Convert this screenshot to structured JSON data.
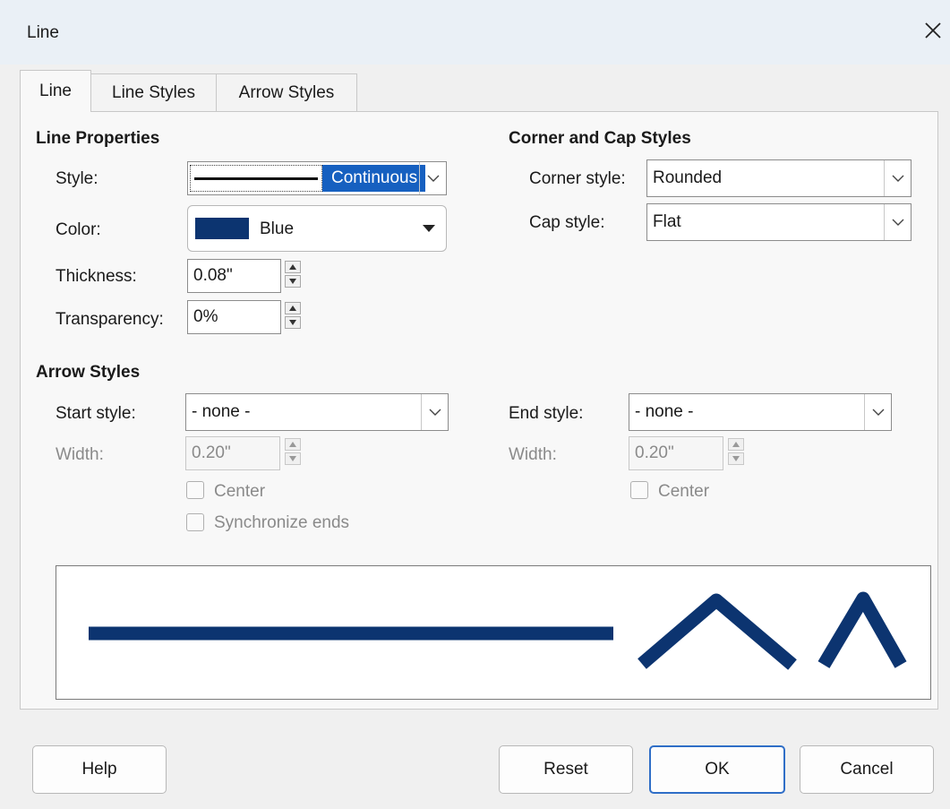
{
  "dialog": {
    "title": "Line"
  },
  "tabs": [
    {
      "label": "Line",
      "active": true
    },
    {
      "label": "Line Styles",
      "active": false
    },
    {
      "label": "Arrow Styles",
      "active": false
    }
  ],
  "line_properties": {
    "heading": "Line Properties",
    "style_label": "Style:",
    "style_value": "Continuous",
    "color_label": "Color:",
    "color_value": "Blue",
    "color_hex": "#0c3470",
    "thickness_label": "Thickness:",
    "thickness_value": "0.08\"",
    "transparency_label": "Transparency:",
    "transparency_value": "0%"
  },
  "corner_cap": {
    "heading": "Corner and Cap Styles",
    "corner_label": "Corner style:",
    "corner_value": "Rounded",
    "cap_label": "Cap style:",
    "cap_value": "Flat"
  },
  "arrow_styles": {
    "heading": "Arrow Styles",
    "start_label": "Start style:",
    "start_value": "- none -",
    "start_width_label": "Width:",
    "start_width_value": "0.20\"",
    "start_center_label": "Center",
    "sync_label": "Synchronize ends",
    "end_label": "End style:",
    "end_value": "- none -",
    "end_width_label": "Width:",
    "end_width_value": "0.20\"",
    "end_center_label": "Center"
  },
  "buttons": {
    "help": "Help",
    "reset": "Reset",
    "ok": "OK",
    "cancel": "Cancel"
  },
  "colors": {
    "accent": "#0a64c8",
    "line": "#0c3470"
  }
}
